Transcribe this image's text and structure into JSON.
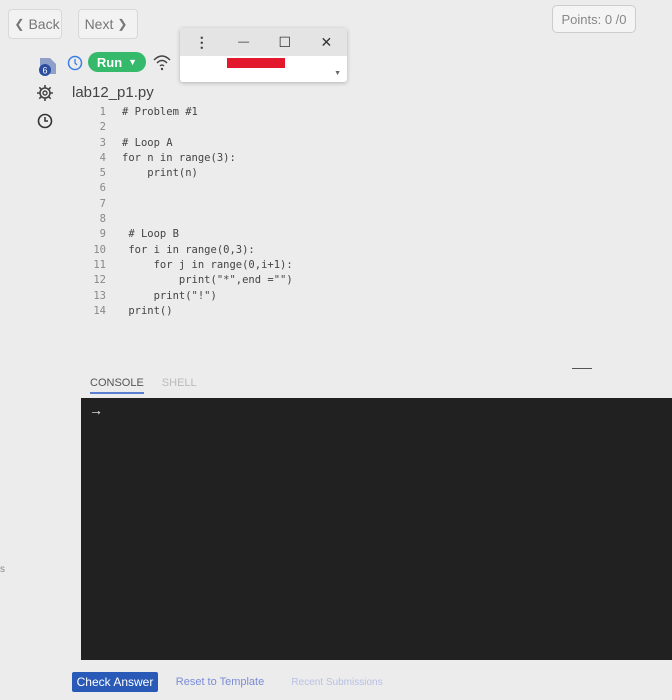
{
  "nav": {
    "back_label": "Back",
    "next_label": "Next",
    "points": "Points: 0 /0"
  },
  "sidebar": {
    "badge_count": "6"
  },
  "toolbar": {
    "run_label": "Run"
  },
  "editor": {
    "filename": "lab12_p1.py",
    "lines": [
      {
        "n": "1",
        "code": "# Problem #1"
      },
      {
        "n": "2",
        "code": ""
      },
      {
        "n": "3",
        "code": "# Loop A"
      },
      {
        "n": "4",
        "code": "for n in range(3):"
      },
      {
        "n": "5",
        "code": "    print(n)"
      },
      {
        "n": "6",
        "code": ""
      },
      {
        "n": "7",
        "code": ""
      },
      {
        "n": "8",
        "code": ""
      },
      {
        "n": "9",
        "code": " # Loop B"
      },
      {
        "n": "10",
        "code": " for i in range(0,3):"
      },
      {
        "n": "11",
        "code": "     for j in range(0,i+1):"
      },
      {
        "n": "12",
        "code": "         print(\"*\",end =\"\")"
      },
      {
        "n": "13",
        "code": "     print(\"!\")"
      },
      {
        "n": "14",
        "code": " print()"
      }
    ]
  },
  "popup": {
    "menu_glyph": "⋮",
    "min_glyph": "—",
    "max_glyph": "☐",
    "close_glyph": "✕"
  },
  "console": {
    "tab_console": "CONSOLE",
    "tab_shell": "SHELL",
    "prompt": "→"
  },
  "bottom": {
    "check_answer": "Check Answer",
    "reset_template": "Reset to Template",
    "recent_submissions": "Recent Submissions"
  },
  "edge_text": "s"
}
